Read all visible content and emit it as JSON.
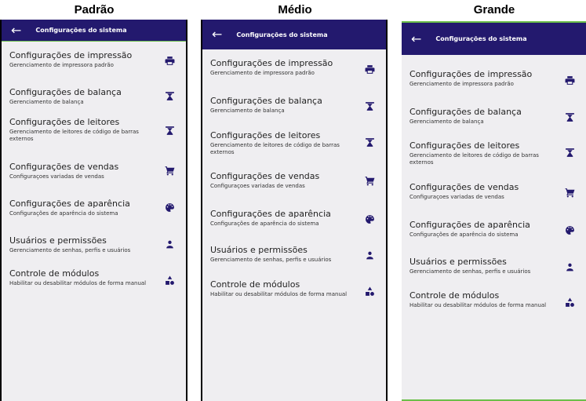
{
  "variants": [
    {
      "name": "Padrão"
    },
    {
      "name": "Médio"
    },
    {
      "name": "Grande"
    }
  ],
  "appbar": {
    "back_icon": "arrow-left-icon",
    "title": "Configurações do sistema"
  },
  "colors": {
    "appbar_bg": "#23196e",
    "screen_bg": "#efeef1",
    "icon": "#23196e"
  },
  "items": [
    {
      "label": "Configurações de impressão",
      "desc": "Gerenciamento de impressora padrão",
      "icon": "printer-icon"
    },
    {
      "label": "Configurações de balança",
      "desc": "Gerenciamento de balança",
      "icon": "scale-icon"
    },
    {
      "label": "Configurações de leitores",
      "desc": "Gerenciamento de leitores de código de barras externos",
      "icon": "scale-icon"
    },
    {
      "label": "Configurações de vendas",
      "desc": "Configuraçoes variadas de vendas",
      "icon": "shopping-cart-icon"
    },
    {
      "label": "Configurações de aparência",
      "desc": "Configurações de aparência do sistema",
      "icon": "palette-icon"
    },
    {
      "label": "Usuários e permissões",
      "desc": "Gerenciamento de senhas, perfis e usuários",
      "icon": "person-icon"
    },
    {
      "label": "Controle de módulos",
      "desc": "Habilitar ou desabilitar módulos de forma manual",
      "icon": "shapes-icon"
    }
  ]
}
